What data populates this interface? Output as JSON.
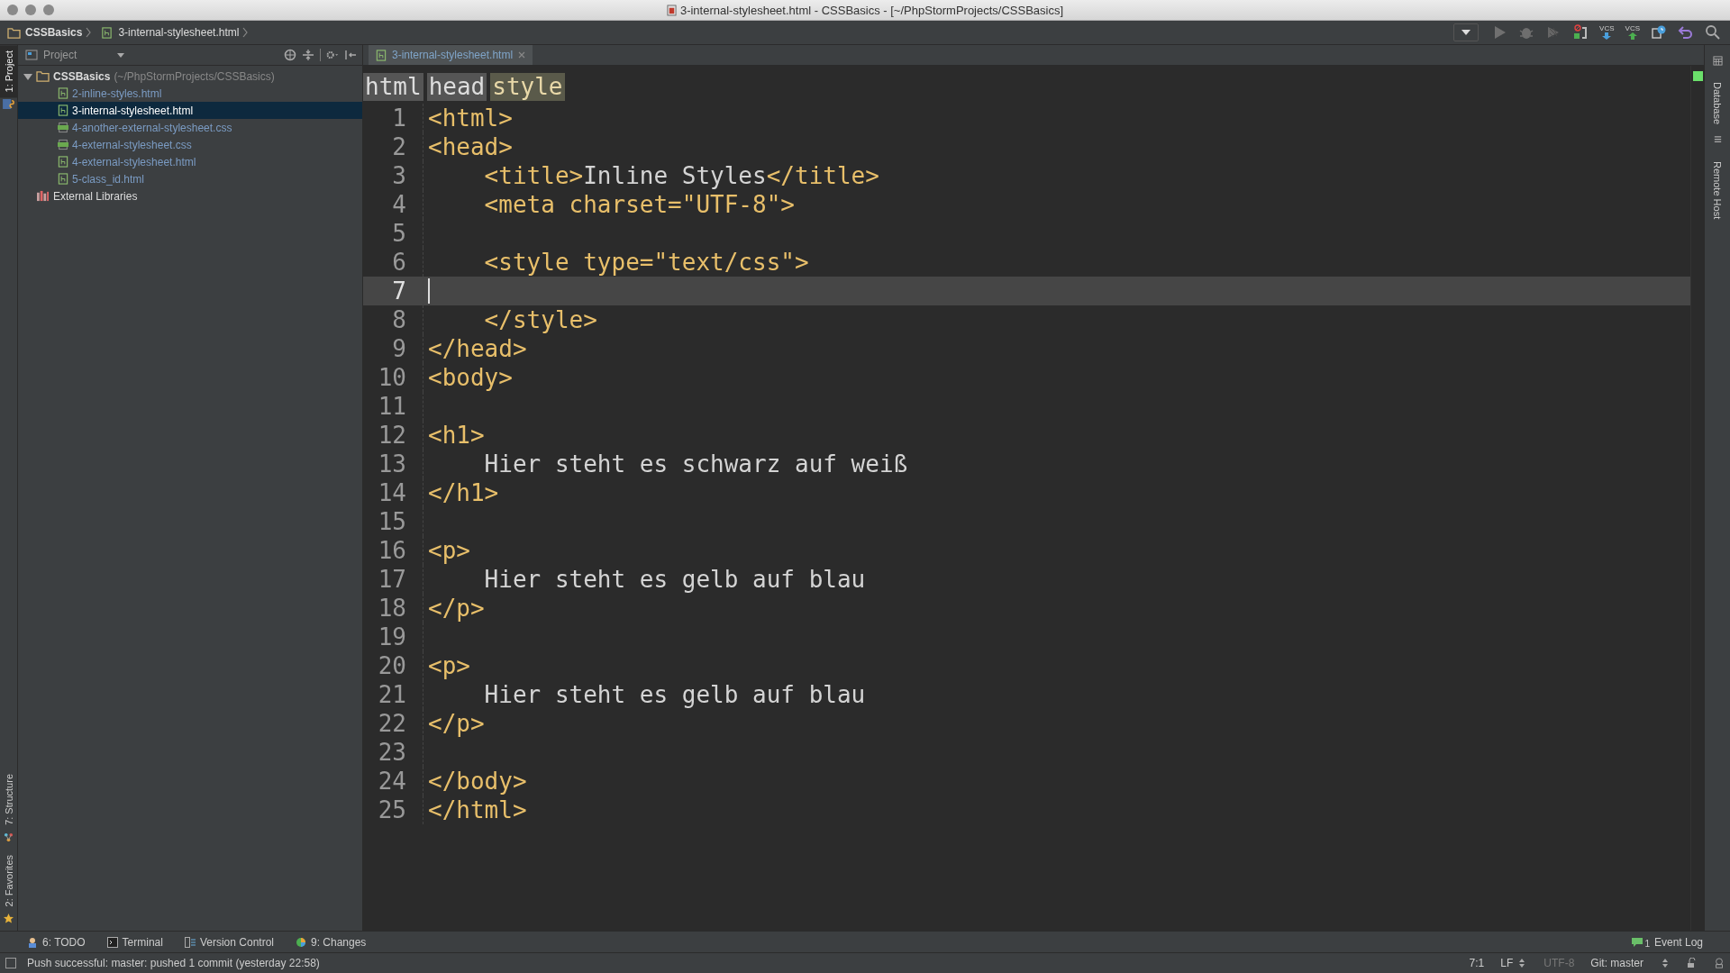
{
  "window": {
    "title": "3-internal-stylesheet.html - CSSBasics - [~/PhpStormProjects/CSSBasics]"
  },
  "nav_bar": {
    "breadcrumbs": [
      {
        "kind": "folder",
        "label": "CSSBasics"
      },
      {
        "kind": "html",
        "label": "3-internal-stylesheet.html"
      }
    ],
    "toolbar": [
      {
        "kind": "dropdown"
      },
      {
        "kind": "run"
      },
      {
        "kind": "debug"
      },
      {
        "kind": "coverage"
      },
      {
        "kind": "stop-listen"
      },
      {
        "kind": "vcs-update",
        "label": "VCS"
      },
      {
        "kind": "vcs-commit",
        "label": "VCS"
      },
      {
        "kind": "history"
      },
      {
        "kind": "revert"
      },
      {
        "kind": "search"
      }
    ]
  },
  "left_strip": {
    "top": [
      {
        "label": "1: Project",
        "selected": true
      }
    ],
    "bottom": [
      {
        "kind": "structure",
        "label": "7: Structure"
      },
      {
        "kind": "favorites",
        "label": "2: Favorites"
      }
    ]
  },
  "right_strip": [
    {
      "kind": "database",
      "label": "Database"
    },
    {
      "kind": "remote",
      "label": "Remote Host"
    }
  ],
  "project": {
    "title": "Project",
    "tree": [
      {
        "kind": "folder",
        "label": "CSSBasics",
        "path": "(~/PhpStormProjects/CSSBasics)",
        "expanded": true,
        "selected": false,
        "children": [
          {
            "kind": "html",
            "label": "2-inline-styles.html",
            "selected": false
          },
          {
            "kind": "html",
            "label": "3-internal-stylesheet.html",
            "selected": true
          },
          {
            "kind": "css",
            "label": "4-another-external-stylesheet.css",
            "selected": false
          },
          {
            "kind": "css",
            "label": "4-external-stylesheet.css",
            "selected": false
          },
          {
            "kind": "html",
            "label": "4-external-stylesheet.html",
            "selected": false
          },
          {
            "kind": "html",
            "label": "5-class_id.html",
            "selected": false
          }
        ]
      },
      {
        "kind": "library",
        "label": "External Libraries",
        "selected": false
      }
    ]
  },
  "editor": {
    "tabs": [
      {
        "label": "3-internal-stylesheet.html",
        "selected": true
      }
    ],
    "breadcrumbs": [
      {
        "label": "html",
        "selected": false
      },
      {
        "label": "head",
        "selected": false
      },
      {
        "label": "style",
        "selected": true
      }
    ],
    "lines": [
      {
        "number": "1",
        "current": false,
        "indent": false,
        "segments": [
          {
            "kind": "tag",
            "text": "<html>"
          }
        ]
      },
      {
        "number": "2",
        "current": false,
        "indent": false,
        "segments": [
          {
            "kind": "tag",
            "text": "<head>"
          }
        ]
      },
      {
        "number": "3",
        "current": false,
        "indent": true,
        "segments": [
          {
            "kind": "tag",
            "text": "<title>"
          },
          {
            "kind": "text",
            "text": "Inline Styles"
          },
          {
            "kind": "tag",
            "text": "</title>"
          }
        ]
      },
      {
        "number": "4",
        "current": false,
        "indent": true,
        "segments": [
          {
            "kind": "tag",
            "text": "<meta charset=\"UTF-8\">"
          }
        ]
      },
      {
        "number": "5",
        "current": false
      },
      {
        "number": "6",
        "current": false,
        "indent": true,
        "segments": [
          {
            "kind": "tag",
            "text": "<style type=\"text/css\">"
          }
        ]
      },
      {
        "number": "7",
        "current": true
      },
      {
        "number": "8",
        "current": false,
        "indent": true,
        "segments": [
          {
            "kind": "tag",
            "text": "</style>"
          }
        ]
      },
      {
        "number": "9",
        "current": false,
        "indent": false,
        "segments": [
          {
            "kind": "tag",
            "text": "</head>"
          }
        ]
      },
      {
        "number": "10",
        "current": false,
        "indent": false,
        "segments": [
          {
            "kind": "tag",
            "text": "<body>"
          }
        ]
      },
      {
        "number": "11",
        "current": false
      },
      {
        "number": "12",
        "current": false,
        "indent": false,
        "segments": [
          {
            "kind": "tag",
            "text": "<h1>"
          }
        ]
      },
      {
        "number": "13",
        "current": false,
        "indent": true,
        "segments": [
          {
            "kind": "text",
            "text": "Hier steht es schwarz auf weiß"
          }
        ]
      },
      {
        "number": "14",
        "current": false,
        "indent": false,
        "segments": [
          {
            "kind": "tag",
            "text": "</h1>"
          }
        ]
      },
      {
        "number": "15",
        "current": false
      },
      {
        "number": "16",
        "current": false,
        "indent": false,
        "segments": [
          {
            "kind": "tag",
            "text": "<p>"
          }
        ]
      },
      {
        "number": "17",
        "current": false,
        "indent": true,
        "segments": [
          {
            "kind": "text",
            "text": "Hier steht es gelb auf blau"
          }
        ]
      },
      {
        "number": "18",
        "current": false,
        "indent": false,
        "segments": [
          {
            "kind": "tag",
            "text": "</p>"
          }
        ]
      },
      {
        "number": "19",
        "current": false
      },
      {
        "number": "20",
        "current": false,
        "indent": false,
        "segments": [
          {
            "kind": "tag",
            "text": "<p>"
          }
        ]
      },
      {
        "number": "21",
        "current": false,
        "indent": true,
        "segments": [
          {
            "kind": "text",
            "text": "Hier steht es gelb auf blau"
          }
        ]
      },
      {
        "number": "22",
        "current": false,
        "indent": false,
        "segments": [
          {
            "kind": "tag",
            "text": "</p>"
          }
        ]
      },
      {
        "number": "23",
        "current": false
      },
      {
        "number": "24",
        "current": false,
        "indent": false,
        "segments": [
          {
            "kind": "tag",
            "text": "</body>"
          }
        ]
      },
      {
        "number": "25",
        "current": false,
        "indent": false,
        "segments": [
          {
            "kind": "tag",
            "text": "</html>"
          }
        ]
      }
    ]
  },
  "tool_tabs": [
    {
      "kind": "todo",
      "label": "6: TODO"
    },
    {
      "kind": "terminal",
      "label": "Terminal"
    },
    {
      "kind": "vcs",
      "label": "Version Control"
    },
    {
      "kind": "changes",
      "label": "9: Changes"
    }
  ],
  "event_log": {
    "label": "Event Log",
    "count": "1"
  },
  "status_bar": {
    "message": "Push successful: master: pushed 1 commit (yesterday 22:58)",
    "position": "7:1",
    "line_separator": "LF",
    "encoding": "UTF-8",
    "branch": "Git: master"
  }
}
